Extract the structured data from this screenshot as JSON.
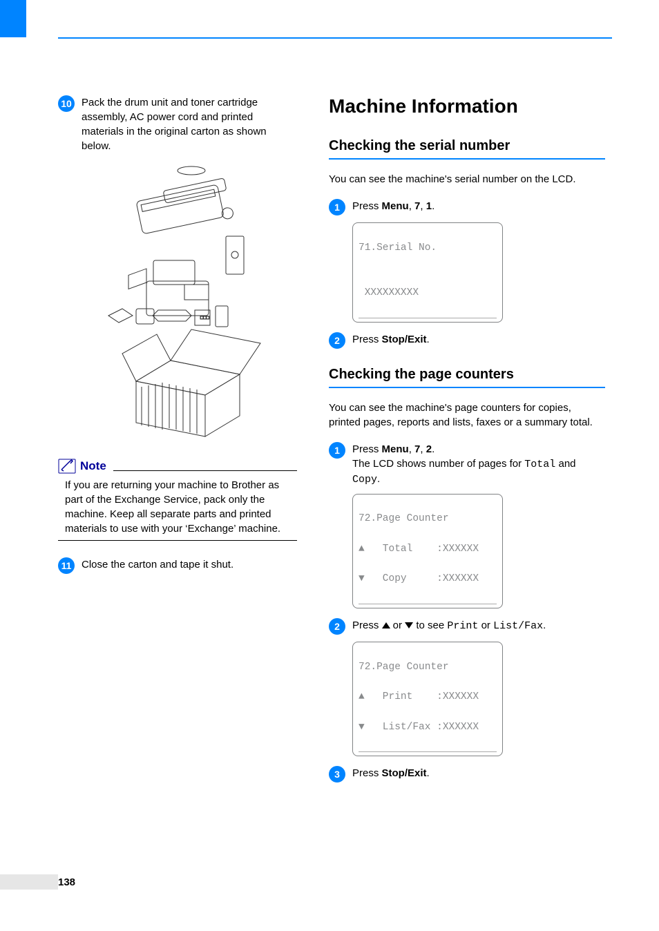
{
  "page_number": "138",
  "left": {
    "step10": {
      "num": "10",
      "text": "Pack the drum unit and toner cartridge assembly, AC power cord and printed materials in the original carton as shown below."
    },
    "note": {
      "title": "Note",
      "body": "If you are returning your machine to Brother as part of the Exchange Service, pack only the machine. Keep all separate parts and printed materials to use with your ‘Exchange’ machine."
    },
    "step11": {
      "num": "11",
      "text": "Close the carton and tape it shut."
    }
  },
  "right": {
    "h1": "Machine Information",
    "serial": {
      "h2": "Checking the serial number",
      "intro": "You can see the machine's serial number on the LCD.",
      "step1": {
        "num": "1",
        "pre": "Press ",
        "bold": "Menu",
        "mid": ", ",
        "b2": "7",
        "mid2": ", ",
        "b3": "1",
        "end": "."
      },
      "lcd1": {
        "l1": "71.Serial No.",
        "l2": "",
        "l3": " XXXXXXXXX"
      },
      "step2": {
        "num": "2",
        "pre": "Press ",
        "bold": "Stop/Exit",
        "end": "."
      }
    },
    "counters": {
      "h2": "Checking the page counters",
      "intro": "You can see the machine's page counters for copies, printed pages, reports and lists, faxes or a summary total.",
      "step1": {
        "num": "1",
        "pre": "Press ",
        "bold": "Menu",
        "mid": ", ",
        "b2": "7",
        "mid2": ", ",
        "b3": "2",
        "end": ".",
        "sub_pre": "The LCD shows number of pages for ",
        "sub_m1": "Total",
        "sub_mid": " and ",
        "sub_m2": "Copy",
        "sub_end": "."
      },
      "lcd1": {
        "l1": "72.Page Counter",
        "l2": "▲   Total    :XXXXXX",
        "l3": "▼   Copy     :XXXXXX"
      },
      "step2": {
        "num": "2",
        "pre": "Press ",
        "mid": " or ",
        "post": " to see ",
        "m1": "Print",
        "mid2": " or ",
        "m2": "List/Fax",
        "end": "."
      },
      "lcd2": {
        "l1": "72.Page Counter",
        "l2": "▲   Print    :XXXXXX",
        "l3": "▼   List/Fax :XXXXXX"
      },
      "step3": {
        "num": "3",
        "pre": "Press ",
        "bold": "Stop/Exit",
        "end": "."
      }
    }
  }
}
